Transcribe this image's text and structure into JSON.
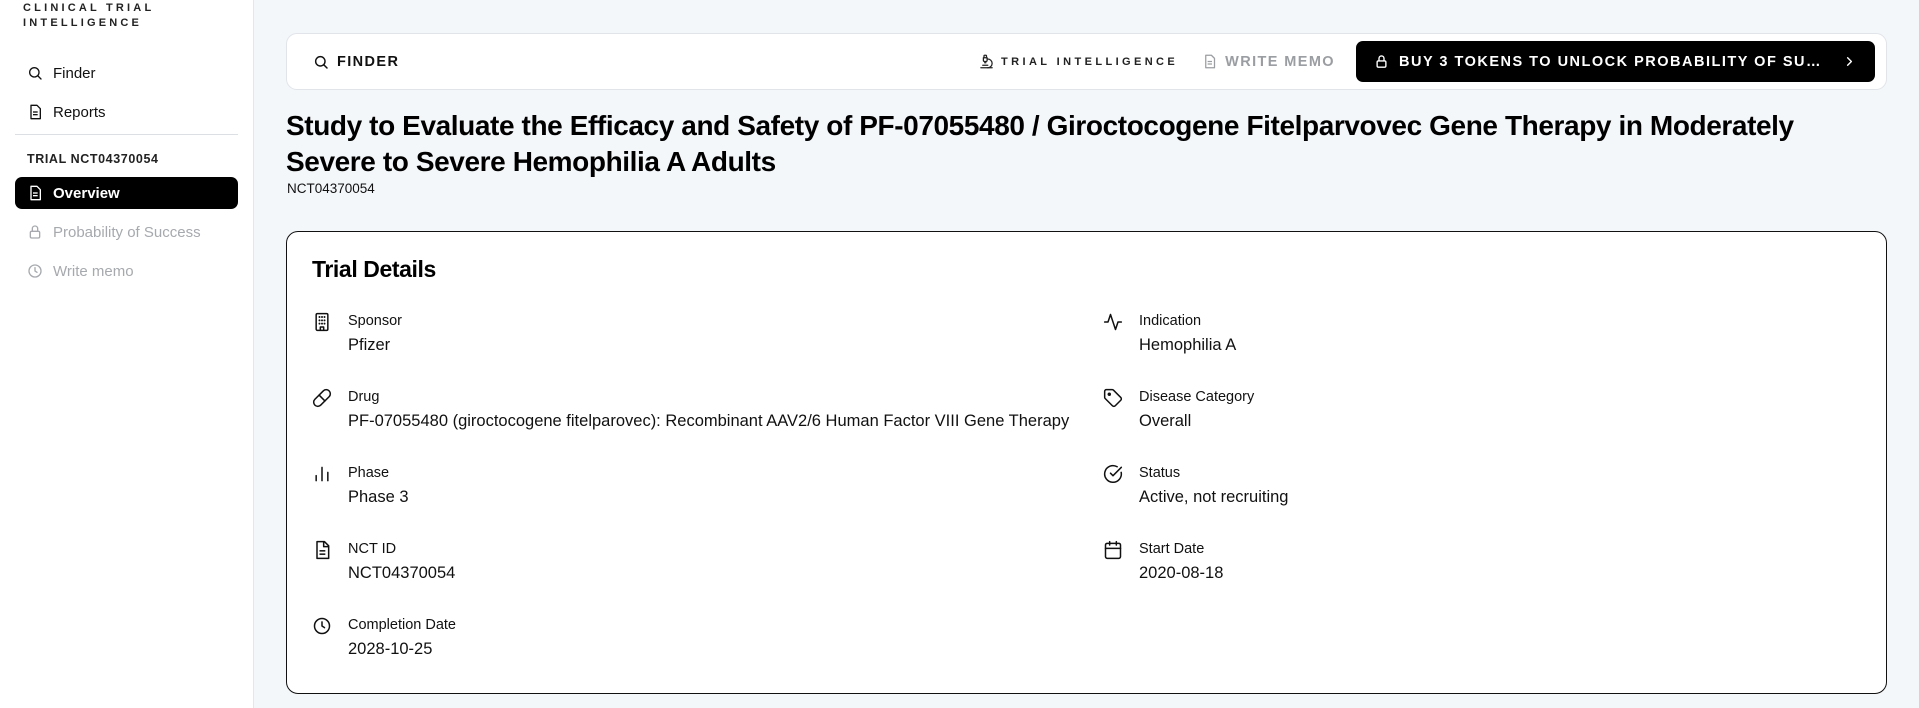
{
  "sidebar": {
    "brand": "CLINICAL TRIAL INTELLIGENCE",
    "nav": [
      {
        "label": "Finder",
        "icon": "search-icon"
      },
      {
        "label": "Reports",
        "icon": "document-icon"
      }
    ],
    "section_label": "TRIAL NCT04370054",
    "trial_nav": [
      {
        "label": "Overview",
        "icon": "document-icon",
        "state": "active"
      },
      {
        "label": "Probability of Success",
        "icon": "lock-icon",
        "state": "disabled"
      },
      {
        "label": "Write memo",
        "icon": "clock-icon",
        "state": "disabled"
      }
    ]
  },
  "topbar": {
    "finder_label": "FINDER",
    "trial_intelligence_label": "TRIAL INTELLIGENCE",
    "write_memo_label": "WRITE MEMO",
    "buy_button_label": "BUY 3 TOKENS TO UNLOCK PROBABILITY OF SUCCE…"
  },
  "page": {
    "title": "Study to Evaluate the Efficacy and Safety of PF-07055480 / Giroctocogene Fitelparvovec Gene Therapy in Moderately Severe to Severe Hemophilia A Adults",
    "nct_id": "NCT04370054"
  },
  "trial_details": {
    "heading": "Trial Details",
    "left": [
      {
        "label": "Sponsor",
        "value": "Pfizer",
        "icon": "building-icon"
      },
      {
        "label": "Drug",
        "value": "PF-07055480 (giroctocogene fitelparovec): Recombinant AAV2/6 Human Factor VIII Gene Therapy",
        "icon": "pill-icon"
      },
      {
        "label": "Phase",
        "value": "Phase 3",
        "icon": "bar-chart-icon"
      },
      {
        "label": "NCT ID",
        "value": "NCT04370054",
        "icon": "file-text-icon"
      },
      {
        "label": "Completion Date",
        "value": "2028-10-25",
        "icon": "clock-icon"
      }
    ],
    "right": [
      {
        "label": "Indication",
        "value": "Hemophilia A",
        "icon": "activity-icon"
      },
      {
        "label": "Disease Category",
        "value": "Overall",
        "icon": "tag-icon"
      },
      {
        "label": "Status",
        "value": "Active, not recruiting",
        "icon": "check-circle-icon"
      },
      {
        "label": "Start Date",
        "value": "2020-08-18",
        "icon": "calendar-icon"
      }
    ]
  },
  "colors": {
    "background": "#f4f7fa",
    "active_nav": "#000000",
    "disabled_text": "#a6a9ad",
    "primary_button": "#000000"
  }
}
